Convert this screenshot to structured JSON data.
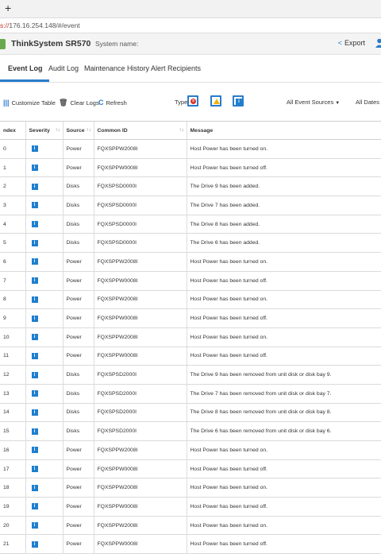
{
  "browser": {
    "new_tab_label": "+",
    "url_scheme": "s://",
    "url_rest": "176.16.254.148/#/event"
  },
  "header": {
    "product": "ThinkSystem SR570",
    "system_name_label": "System name:",
    "export_label": "Export"
  },
  "tabs": [
    {
      "label": "Event Log"
    },
    {
      "label": "Audit Log"
    },
    {
      "label": "Maintenance History"
    },
    {
      "label": "Alert Recipients"
    }
  ],
  "toolbar": {
    "customize": "Customize Table",
    "clear": "Clear Logs",
    "refresh": "Refresh",
    "type_label": "Type:",
    "sources": "All Event Sources",
    "dates": "All Dates"
  },
  "table": {
    "columns": [
      "ndex",
      "Severity",
      "Source",
      "Common ID",
      "Message"
    ],
    "rows": [
      {
        "index": "0",
        "severity": "i",
        "source": "Power",
        "id": "FQXSPPW2008I",
        "message": "Host Power has been turned on."
      },
      {
        "index": "1",
        "severity": "i",
        "source": "Power",
        "id": "FQXSPPW0008I",
        "message": "Host Power has been turned off."
      },
      {
        "index": "2",
        "severity": "i",
        "source": "Disks",
        "id": "FQXSPSD0000I",
        "message": "The Drive 9 has been added."
      },
      {
        "index": "3",
        "severity": "i",
        "source": "Disks",
        "id": "FQXSPSD0000I",
        "message": "The Drive 7 has been added."
      },
      {
        "index": "4",
        "severity": "i",
        "source": "Disks",
        "id": "FQXSPSD0000I",
        "message": "The Drive 8 has been added."
      },
      {
        "index": "5",
        "severity": "i",
        "source": "Disks",
        "id": "FQXSPSD0000I",
        "message": "The Drive 6 has been added."
      },
      {
        "index": "6",
        "severity": "i",
        "source": "Power",
        "id": "FQXSPPW2008I",
        "message": "Host Power has been turned on."
      },
      {
        "index": "7",
        "severity": "i",
        "source": "Power",
        "id": "FQXSPPW0008I",
        "message": "Host Power has been turned off."
      },
      {
        "index": "8",
        "severity": "i",
        "source": "Power",
        "id": "FQXSPPW2008I",
        "message": "Host Power has been turned on."
      },
      {
        "index": "9",
        "severity": "i",
        "source": "Power",
        "id": "FQXSPPW0008I",
        "message": "Host Power has been turned off."
      },
      {
        "index": "10",
        "severity": "i",
        "source": "Power",
        "id": "FQXSPPW2008I",
        "message": "Host Power has been turned on."
      },
      {
        "index": "11",
        "severity": "i",
        "source": "Power",
        "id": "FQXSPPW0008I",
        "message": "Host Power has been turned off."
      },
      {
        "index": "12",
        "severity": "i",
        "source": "Disks",
        "id": "FQXSPSD2000I",
        "message": "The Drive 9 has been removed from unit disk or disk bay 9."
      },
      {
        "index": "13",
        "severity": "i",
        "source": "Disks",
        "id": "FQXSPSD2000I",
        "message": "The Drive 7 has been removed from unit disk or disk bay 7."
      },
      {
        "index": "14",
        "severity": "i",
        "source": "Disks",
        "id": "FQXSPSD2000I",
        "message": "The Drive 8 has been removed from unit disk or disk bay 8."
      },
      {
        "index": "15",
        "severity": "i",
        "source": "Disks",
        "id": "FQXSPSD2000I",
        "message": "The Drive 6 has been removed from unit disk or disk bay 6."
      },
      {
        "index": "16",
        "severity": "i",
        "source": "Power",
        "id": "FQXSPPW2008I",
        "message": "Host Power has been turned on."
      },
      {
        "index": "17",
        "severity": "i",
        "source": "Power",
        "id": "FQXSPPW0008I",
        "message": "Host Power has been turned off."
      },
      {
        "index": "18",
        "severity": "i",
        "source": "Power",
        "id": "FQXSPPW2008I",
        "message": "Host Power has been turned on."
      },
      {
        "index": "19",
        "severity": "i",
        "source": "Power",
        "id": "FQXSPPW0008I",
        "message": "Host Power has been turned off."
      },
      {
        "index": "20",
        "severity": "i",
        "source": "Power",
        "id": "FQXSPPW2008I",
        "message": "Host Power has been turned on."
      },
      {
        "index": "21",
        "severity": "i",
        "source": "Power",
        "id": "FQXSPPW0008I",
        "message": "Host Power has been turned off."
      }
    ]
  },
  "colors": {
    "accent": "#2a7ccc",
    "info": "#1f7fcf",
    "error": "#d9342b",
    "warning": "#f0b400",
    "logo": "#6aa84f"
  }
}
